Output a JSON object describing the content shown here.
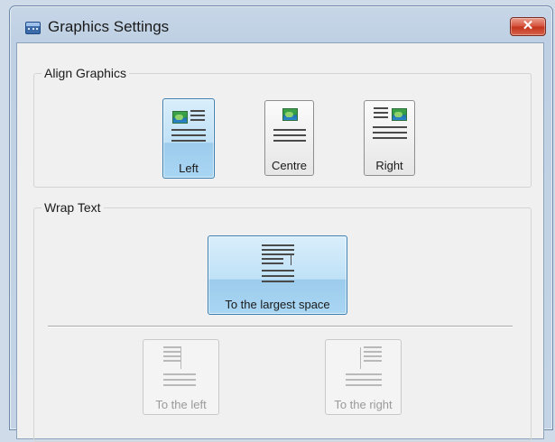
{
  "window": {
    "title": "Graphics Settings",
    "close_glyph": "✕"
  },
  "align": {
    "group_label": "Align Graphics",
    "options": [
      {
        "label": "Left",
        "state": "selected"
      },
      {
        "label": "Centre",
        "state": "normal"
      },
      {
        "label": "Right",
        "state": "normal"
      }
    ]
  },
  "wrap": {
    "group_label": "Wrap Text",
    "options": [
      {
        "label": "To the largest space",
        "state": "selected"
      },
      {
        "label": "To the left",
        "state": "disabled"
      },
      {
        "label": "To the right",
        "state": "disabled"
      }
    ]
  },
  "colors": {
    "selected_tile": "#a9d6f3",
    "title_bar": "#c7d6e7",
    "close_button": "#c2341d"
  }
}
